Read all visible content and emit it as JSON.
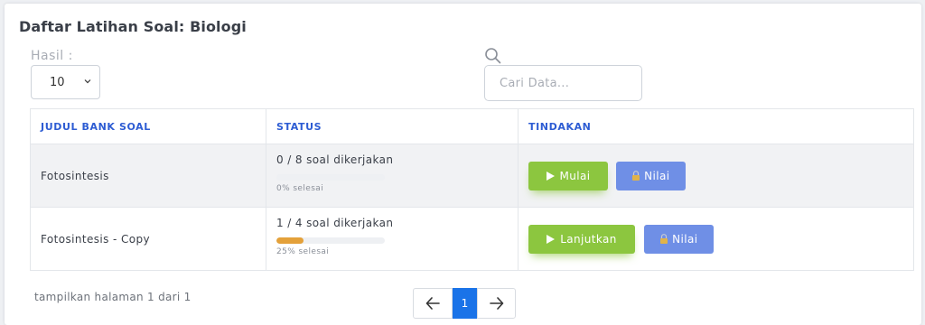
{
  "page": {
    "title": "Daftar Latihan Soal: Biologi"
  },
  "filters": {
    "hasil_label": "Hasil :",
    "hasil_value": "10",
    "search_placeholder": "Cari Data..."
  },
  "table": {
    "headers": [
      "JUDUL BANK SOAL",
      "STATUS",
      "TINDAKAN"
    ],
    "rows": [
      {
        "title": "Fotosintesis",
        "status": "0 / 8 soal dikerjakan",
        "progress": 0,
        "percent": "0% selesai",
        "action": "Mulai",
        "score": "Nilai"
      },
      {
        "title": "Fotosintesis - Copy",
        "status": "1 / 4 soal dikerjakan",
        "progress": 0.25,
        "percent": "25% selesai",
        "action": "Lanjutkan",
        "score": "Nilai"
      }
    ]
  },
  "footer": {
    "info": "tampilkan halaman 1 dari 1",
    "current_page": "1"
  },
  "colors": {
    "header_text": "#2d5cd3",
    "primary_action": "#8cc63f",
    "secondary_action": "#6f8fe6",
    "progress": "#e4a13a",
    "active_page": "#1a73e8"
  },
  "icons": [
    "search-icon",
    "chevron-down-icon",
    "play-icon",
    "lock-icon",
    "arrow-left-icon",
    "arrow-right-icon"
  ]
}
